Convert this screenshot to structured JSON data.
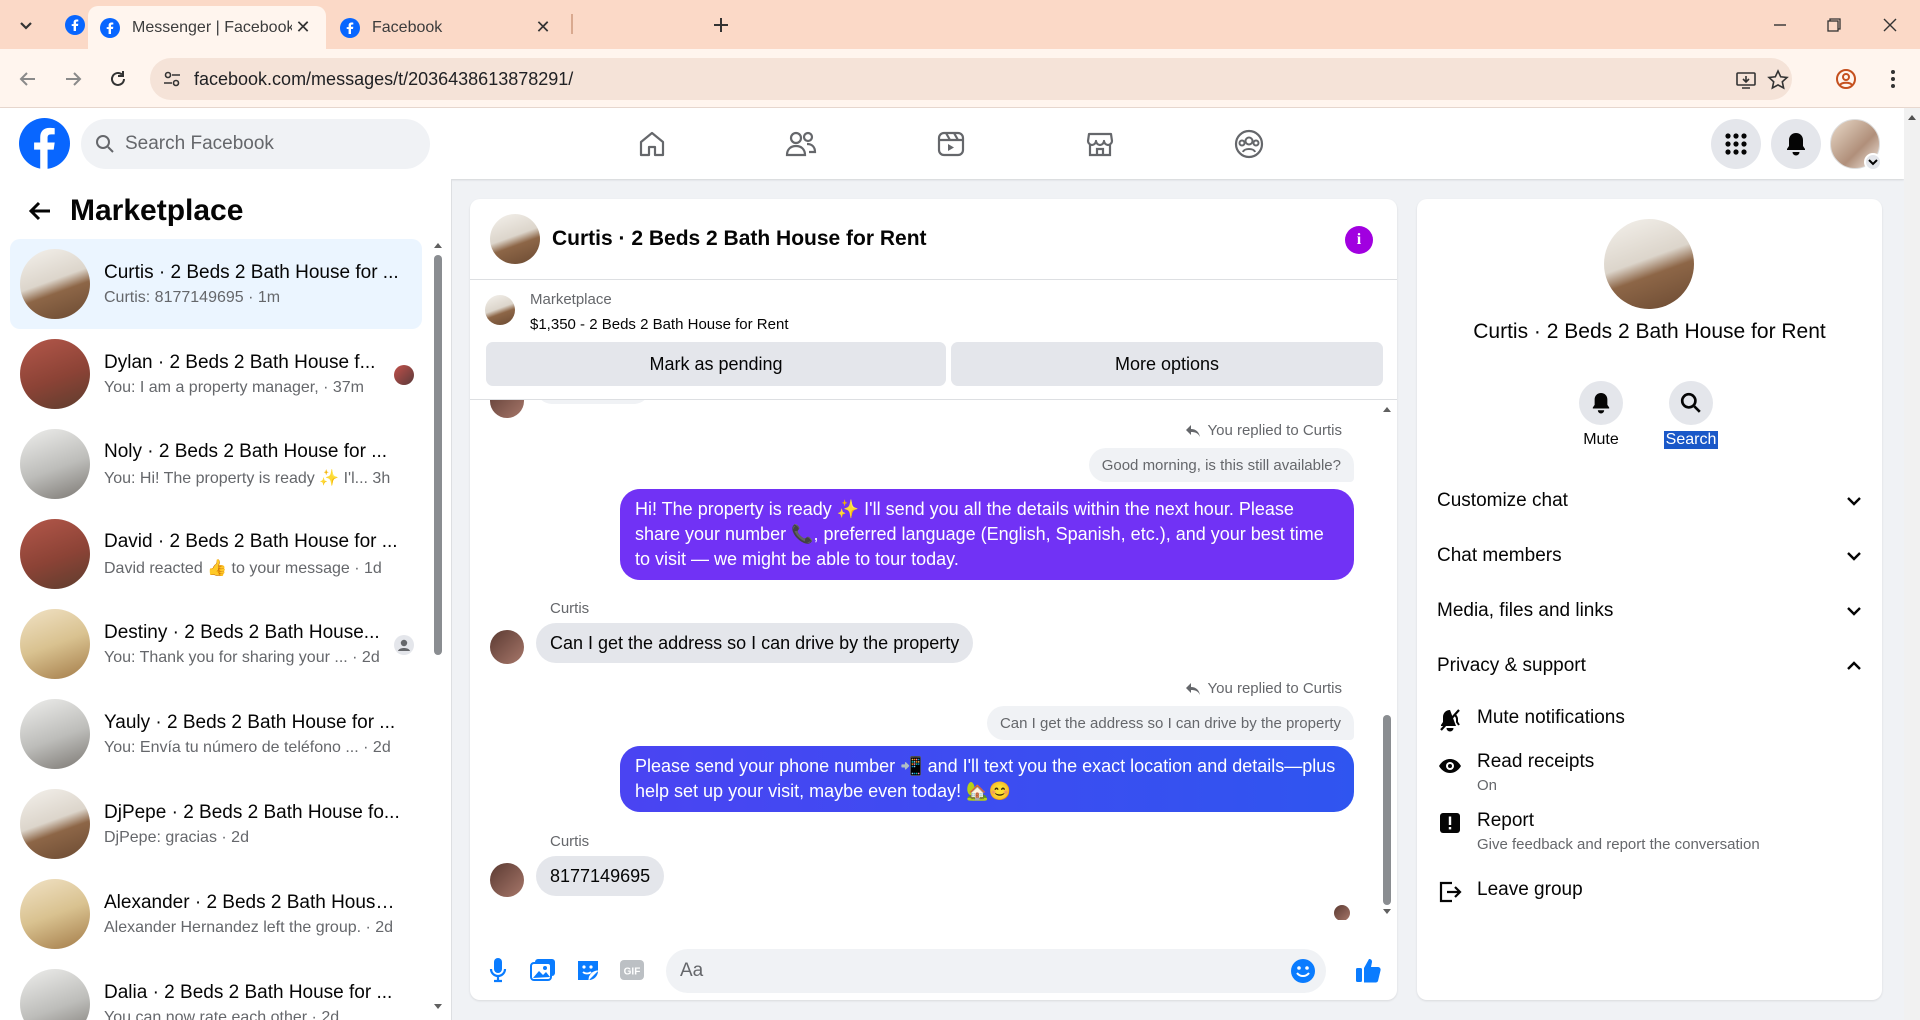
{
  "browser": {
    "tabs": [
      {
        "title": "Messenger | Facebook",
        "active": true
      },
      {
        "title": "Facebook",
        "active": false
      }
    ],
    "url": "facebook.com/messages/t/2036438613878291/"
  },
  "fb": {
    "search_placeholder": "Search Facebook",
    "brand_color": "#0866ff"
  },
  "left": {
    "title": "Marketplace",
    "chats": [
      {
        "name": "Curtis · 2 Beds 2 Bath House for ...",
        "sub": "Curtis: 8177149695 · 1m",
        "thumb": "photo",
        "badge": ""
      },
      {
        "name": "Dylan · 2 Beds 2 Bath House f...",
        "sub": "You: I am a property manager, · 37m",
        "thumb": "red",
        "badge": "avatar"
      },
      {
        "name": "Noly · 2 Beds 2 Bath House for ...",
        "sub": "You: Hi! The property is ready ✨ I'l... 3h",
        "thumb": "gray",
        "badge": ""
      },
      {
        "name": "David · 2 Beds 2 Bath House for ...",
        "sub": "David reacted 👍 to your message · 1d",
        "thumb": "red",
        "badge": ""
      },
      {
        "name": "Destiny · 2 Beds 2 Bath House...",
        "sub": "You: Thank you for sharing your ... · 2d",
        "thumb": "warm",
        "badge": "person"
      },
      {
        "name": "Yauly · 2 Beds 2 Bath House for ...",
        "sub": "You: Envía tu número de teléfono ... · 2d",
        "thumb": "gray",
        "badge": ""
      },
      {
        "name": "DjPepe · 2 Beds 2 Bath House fo...",
        "sub": "DjPepe: gracias · 2d",
        "thumb": "photo",
        "badge": ""
      },
      {
        "name": "Alexander · 2 Beds 2 Bath House...",
        "sub": "Alexander Hernandez left the group. · 2d",
        "thumb": "warm",
        "badge": ""
      },
      {
        "name": "Dalia · 2 Beds 2 Bath House for ...",
        "sub": "You can now rate each other · 2d",
        "thumb": "gray",
        "badge": ""
      }
    ]
  },
  "conversation": {
    "title": "Curtis · 2 Beds 2 Bath House for Rent",
    "listing": {
      "source": "Marketplace",
      "price_title": "$1,350 - 2 Beds 2 Bath House for Rent",
      "mark_pending": "Mark as pending",
      "more_options": "More options"
    },
    "messages": {
      "reply1_label": "You replied to Curtis",
      "reply1_quote": "Good morning, is this still available?",
      "out1": "Hi! The property is ready ✨ I'll send you all the details within the next hour. Please share your number 📞, preferred language (English, Spanish, etc.), and your best time to visit — we might be able to tour today.",
      "sender1": "Curtis",
      "in1": "Can I get the address so I can drive by the property",
      "reply2_label": "You replied to Curtis",
      "reply2_quote": "Can I get the address so I can drive by the property",
      "out2": "Please send your phone number 📲 and I'll text you the exact location and details—plus help set up your visit, maybe even today! 🏡😊",
      "sender2": "Curtis",
      "in2": "8177149695"
    },
    "composer_placeholder": "Aa",
    "accent": "#7132f5",
    "accent2": "#2f55f0"
  },
  "info": {
    "name": "Curtis · 2 Beds 2 Bath House for Rent",
    "mute_label": "Mute",
    "search_label": "Search",
    "sections": [
      "Customize chat",
      "Chat members",
      "Media, files and links",
      "Privacy & support"
    ],
    "privacy_items": [
      {
        "title": "Mute notifications",
        "sub": ""
      },
      {
        "title": "Read receipts",
        "sub": "On"
      },
      {
        "title": "Report",
        "sub": "Give feedback and report the conversation"
      },
      {
        "title": "Leave group",
        "sub": ""
      }
    ]
  }
}
